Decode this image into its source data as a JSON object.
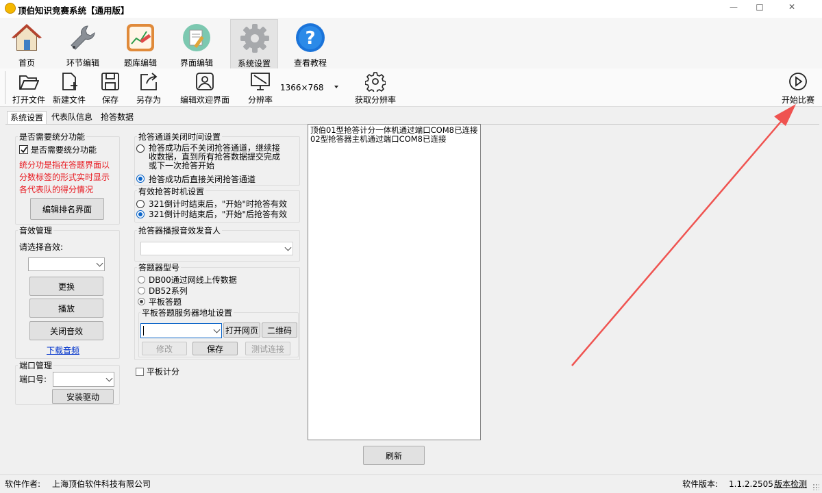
{
  "window": {
    "title": "顶伯知识竞赛系统【通用版】",
    "minimize": "—",
    "restore": "□",
    "close": "✕"
  },
  "ribbon": {
    "tabs": [
      {
        "label": "首页",
        "icon": "home-icon"
      },
      {
        "label": "环节编辑",
        "icon": "wrench-icon"
      },
      {
        "label": "题库编辑",
        "icon": "chart-edit-icon"
      },
      {
        "label": "界面编辑",
        "icon": "palette-edit-icon"
      },
      {
        "label": "系统设置",
        "icon": "gear-icon",
        "active": true
      },
      {
        "label": "查看教程",
        "icon": "help-icon"
      }
    ]
  },
  "toolbar": {
    "open": "打开文件",
    "new": "新建文件",
    "save": "保存",
    "save_as": "另存为",
    "edit_welcome": "编辑欢迎界面",
    "resolution": "分辨率",
    "resolution_value": "1366×768",
    "get_resolution": "获取分辨率",
    "start_match": "开始比赛"
  },
  "tabs": [
    "系统设置",
    "代表队信息",
    "抢答数据"
  ],
  "scoring": {
    "group": "是否需要统分功能",
    "checkbox": "是否需要统分功能",
    "checked": true,
    "note": [
      "统分功是指在答题界面以",
      "分数标签的形式实时显示",
      "各代表队的得分情况"
    ],
    "edit_rank": "编辑排名界面"
  },
  "sound": {
    "group": "音效管理",
    "select_label": "请选择音效:",
    "select_value": "",
    "replace": "更换",
    "play": "播放",
    "close_sound": "关闭音效",
    "download": "下载音频"
  },
  "port": {
    "group": "端口管理",
    "label": "端口号:",
    "value": "",
    "install": "安装驱动"
  },
  "close_channel": {
    "group": "抢答通道关闭时间设置",
    "opt1": [
      "抢答成功后不关闭抢答通道，继续接",
      "收数据，直到所有抢答数据提交完成",
      "或下一次抢答开始"
    ],
    "opt2": "抢答成功后直接关闭抢答通道",
    "selected": 2
  },
  "valid_timing": {
    "group": "有效抢答时机设置",
    "opt1": "321倒计时结束后，\"开始\"时抢答有效",
    "opt2": "321倒计时结束后，\"开始\"后抢答有效",
    "selected": 2
  },
  "announcer": {
    "group": "抢答器播报音效发音人",
    "value": ""
  },
  "device": {
    "group": "答题器型号",
    "options": [
      "DB00通过网线上传数据",
      "DB52系列",
      "平板答题"
    ],
    "selected": 3,
    "server": {
      "group": "平板答题服务器地址设置",
      "value": "",
      "open_web": "打开网页",
      "qrcode": "二维码",
      "modify": "修改",
      "save": "保存",
      "test": "测试连接"
    }
  },
  "tablet_scoring": {
    "label": "平板计分",
    "checked": false
  },
  "log": {
    "lines": [
      "顶伯01型抢答计分一体机通过端口COM8已连接",
      "02型抢答器主机通过端口COM8已连接"
    ]
  },
  "refresh": "刷新",
  "status": {
    "author_label": "软件作者:",
    "author": "上海顶伯软件科技有限公司",
    "version_label": "软件版本:",
    "version": "1.1.2.2505",
    "check": "版本检测"
  },
  "colors": {
    "note_red": "#e8141b",
    "arrow_red": "#ef5350",
    "link_blue": "#0033cc",
    "accent_blue": "#0a64c8"
  }
}
